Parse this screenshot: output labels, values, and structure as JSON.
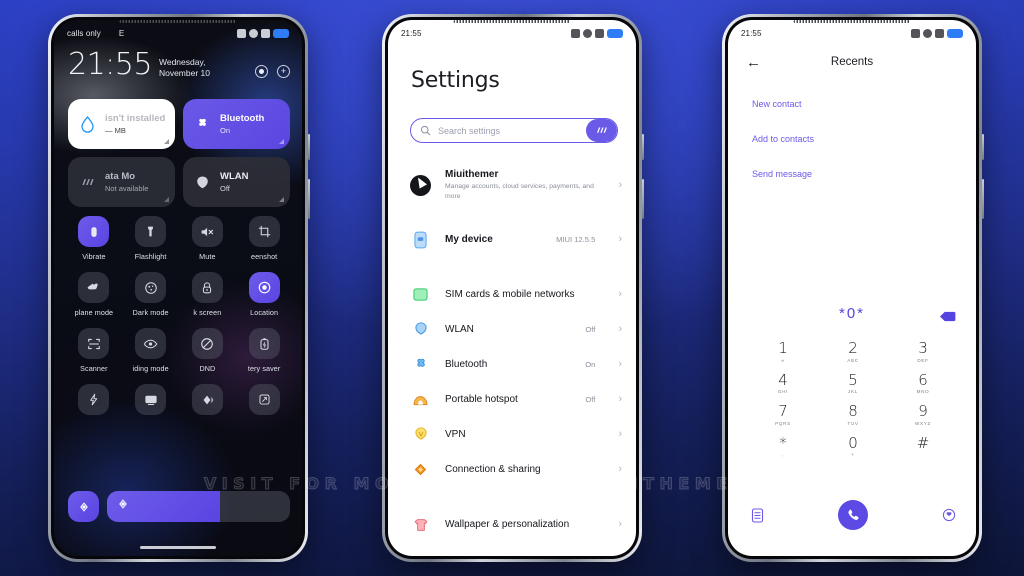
{
  "watermark": "VISIT FOR MORE THEMES - MIUITHEMER.COM",
  "theme": {
    "accent": "#5b4ae3",
    "accent_light": "#6a5ae8",
    "bg_top": "#2b3fc4",
    "bg_bottom": "#0d1538"
  },
  "phone1": {
    "status": {
      "carrier": "calls only",
      "network": "E",
      "time": ""
    },
    "clock": {
      "time": "21:55",
      "date": "Wednesday, November 10"
    },
    "tiles": [
      {
        "title": "isn't installed",
        "subtitle": "— MB",
        "icon": "water-drop-icon",
        "state": "white"
      },
      {
        "title": "Bluetooth",
        "subtitle": "On",
        "icon": "bluetooth-icon",
        "state": "on"
      },
      {
        "title": "ata        Mo",
        "subtitle": "Not available",
        "icon": "mobile-data-icon",
        "state": "dim"
      },
      {
        "title": "WLAN",
        "subtitle": "Off",
        "icon": "wlan-icon",
        "state": "off"
      }
    ],
    "toggles": [
      {
        "label": "Vibrate",
        "icon": "vibrate-icon",
        "on": true
      },
      {
        "label": "Flashlight",
        "icon": "flashlight-icon",
        "on": false
      },
      {
        "label": "Mute",
        "icon": "mute-icon",
        "on": false
      },
      {
        "label": "eenshot",
        "icon": "screenshot-icon",
        "on": false
      },
      {
        "label": "plane mode",
        "icon": "airplane-icon",
        "on": false
      },
      {
        "label": "Dark mode",
        "icon": "dark-mode-icon",
        "on": false
      },
      {
        "label": "k screen",
        "icon": "lock-screen-icon",
        "on": false
      },
      {
        "label": "Location",
        "icon": "location-icon",
        "on": true
      },
      {
        "label": "Scanner",
        "icon": "scanner-icon",
        "on": false
      },
      {
        "label": "iding mode",
        "icon": "reading-mode-icon",
        "on": false
      },
      {
        "label": "DND",
        "icon": "do-not-disturb-icon",
        "on": false
      },
      {
        "label": "tery saver",
        "icon": "battery-saver-icon",
        "on": false
      },
      {
        "label": "",
        "icon": "power-icon",
        "on": false
      },
      {
        "label": "",
        "icon": "cast-icon",
        "on": false
      },
      {
        "label": "",
        "icon": "sync-icon",
        "on": false
      },
      {
        "label": "",
        "icon": "rotate-icon",
        "on": false
      }
    ],
    "brightness": {
      "level": 62,
      "icon": "brightness-icon"
    }
  },
  "phone2": {
    "status": {
      "time": "21:55"
    },
    "title": "Settings",
    "search": {
      "placeholder": "Search settings",
      "icon": "search-icon",
      "cap_icon": "data-usage-icon"
    },
    "items": [
      {
        "label": "Miuithemer",
        "sub": "Manage accounts, cloud services, payments, and more",
        "value": "",
        "icon": "account-avatar",
        "type": "account"
      },
      {
        "label": "My device",
        "sub": "",
        "value": "MIUI 12.5.5",
        "icon": "phone-device-icon",
        "type": "row"
      },
      {
        "label": "SIM cards & mobile networks",
        "sub": "",
        "value": "",
        "icon": "sim-card-icon",
        "type": "row"
      },
      {
        "label": "WLAN",
        "sub": "",
        "value": "Off",
        "icon": "wlan-shield-icon",
        "type": "row"
      },
      {
        "label": "Bluetooth",
        "sub": "",
        "value": "On",
        "icon": "bluetooth-icon",
        "type": "row"
      },
      {
        "label": "Portable hotspot",
        "sub": "",
        "value": "Off",
        "icon": "hotspot-icon",
        "type": "row"
      },
      {
        "label": "VPN",
        "sub": "",
        "value": "",
        "icon": "vpn-icon",
        "type": "row"
      },
      {
        "label": "Connection & sharing",
        "sub": "",
        "value": "",
        "icon": "connection-sharing-icon",
        "type": "row"
      },
      {
        "label": "Wallpaper & personalization",
        "sub": "",
        "value": "",
        "icon": "wallpaper-icon",
        "type": "row"
      }
    ]
  },
  "phone3": {
    "status": {
      "time": "21:55"
    },
    "title": "Recents",
    "back_icon": "arrow-left-icon",
    "links": [
      "New contact",
      "Add to contacts",
      "Send message"
    ],
    "dialed_number": "*0*",
    "backspace_icon": "backspace-icon",
    "keys": [
      {
        "digit": "1",
        "letters": "∞"
      },
      {
        "digit": "2",
        "letters": "ABC"
      },
      {
        "digit": "3",
        "letters": "DEF"
      },
      {
        "digit": "4",
        "letters": "GHI"
      },
      {
        "digit": "5",
        "letters": "JKL"
      },
      {
        "digit": "6",
        "letters": "MNO"
      },
      {
        "digit": "7",
        "letters": "PQRS"
      },
      {
        "digit": "8",
        "letters": "TUV"
      },
      {
        "digit": "9",
        "letters": "WXYZ"
      },
      {
        "digit": "*",
        "letters": ","
      },
      {
        "digit": "0",
        "letters": "+"
      },
      {
        "digit": "#",
        "letters": ""
      }
    ],
    "dock": {
      "left_icon": "keypad-list-icon",
      "call_icon": "call-icon",
      "right_icon": "contacts-icon"
    }
  }
}
